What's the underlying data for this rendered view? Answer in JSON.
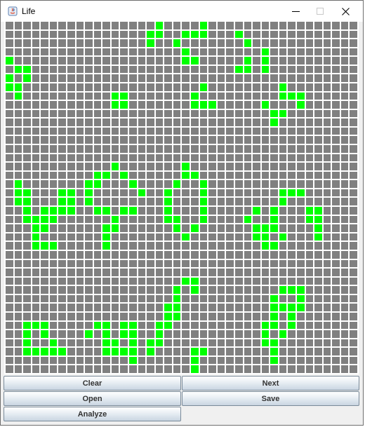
{
  "window": {
    "title": "Life"
  },
  "titlebar": {
    "icon": "java-icon",
    "controls": [
      "minimize-icon",
      "maximize-icon",
      "close-icon"
    ]
  },
  "board": {
    "rows": 40,
    "cols": 40,
    "alive_color": "#00ff00",
    "dead_color": "#808080",
    "grid_line_color": "#ffffff",
    "alive_cells": [
      [
        0,
        17
      ],
      [
        0,
        22
      ],
      [
        1,
        16
      ],
      [
        1,
        17
      ],
      [
        1,
        20
      ],
      [
        1,
        21
      ],
      [
        1,
        22
      ],
      [
        1,
        26
      ],
      [
        2,
        16
      ],
      [
        2,
        19
      ],
      [
        2,
        27
      ],
      [
        3,
        20
      ],
      [
        3,
        29
      ],
      [
        4,
        0
      ],
      [
        4,
        20
      ],
      [
        4,
        21
      ],
      [
        4,
        27
      ],
      [
        4,
        29
      ],
      [
        5,
        1
      ],
      [
        5,
        2
      ],
      [
        5,
        26
      ],
      [
        5,
        27
      ],
      [
        5,
        29
      ],
      [
        6,
        0
      ],
      [
        6,
        2
      ],
      [
        7,
        0
      ],
      [
        7,
        1
      ],
      [
        7,
        22
      ],
      [
        7,
        31
      ],
      [
        8,
        1
      ],
      [
        8,
        12
      ],
      [
        8,
        13
      ],
      [
        8,
        21
      ],
      [
        8,
        31
      ],
      [
        8,
        32
      ],
      [
        8,
        33
      ],
      [
        9,
        12
      ],
      [
        9,
        13
      ],
      [
        9,
        21
      ],
      [
        9,
        22
      ],
      [
        9,
        23
      ],
      [
        9,
        29
      ],
      [
        9,
        33
      ],
      [
        10,
        30
      ],
      [
        10,
        31
      ],
      [
        11,
        30
      ],
      [
        16,
        12
      ],
      [
        16,
        20
      ],
      [
        17,
        10
      ],
      [
        17,
        11
      ],
      [
        17,
        13
      ],
      [
        17,
        20
      ],
      [
        17,
        21
      ],
      [
        18,
        1
      ],
      [
        18,
        9
      ],
      [
        18,
        10
      ],
      [
        18,
        14
      ],
      [
        18,
        19
      ],
      [
        18,
        22
      ],
      [
        19,
        1
      ],
      [
        19,
        2
      ],
      [
        19,
        6
      ],
      [
        19,
        7
      ],
      [
        19,
        9
      ],
      [
        19,
        15
      ],
      [
        19,
        18
      ],
      [
        19,
        22
      ],
      [
        19,
        31
      ],
      [
        19,
        32
      ],
      [
        19,
        33
      ],
      [
        20,
        1
      ],
      [
        20,
        2
      ],
      [
        20,
        6
      ],
      [
        20,
        7
      ],
      [
        20,
        9
      ],
      [
        20,
        18
      ],
      [
        20,
        22
      ],
      [
        20,
        31
      ],
      [
        21,
        2
      ],
      [
        21,
        4
      ],
      [
        21,
        5
      ],
      [
        21,
        6
      ],
      [
        21,
        7
      ],
      [
        21,
        10
      ],
      [
        21,
        11
      ],
      [
        21,
        13
      ],
      [
        21,
        14
      ],
      [
        21,
        18
      ],
      [
        21,
        22
      ],
      [
        21,
        28
      ],
      [
        21,
        30
      ],
      [
        21,
        34
      ],
      [
        21,
        35
      ],
      [
        22,
        2
      ],
      [
        22,
        3
      ],
      [
        22,
        4
      ],
      [
        22,
        5
      ],
      [
        22,
        12
      ],
      [
        22,
        18
      ],
      [
        22,
        19
      ],
      [
        22,
        22
      ],
      [
        22,
        27
      ],
      [
        22,
        30
      ],
      [
        22,
        34
      ],
      [
        22,
        35
      ],
      [
        23,
        3
      ],
      [
        23,
        4
      ],
      [
        23,
        11
      ],
      [
        23,
        12
      ],
      [
        23,
        19
      ],
      [
        23,
        21
      ],
      [
        23,
        28
      ],
      [
        23,
        29
      ],
      [
        23,
        30
      ],
      [
        23,
        35
      ],
      [
        24,
        3
      ],
      [
        24,
        11
      ],
      [
        24,
        20
      ],
      [
        24,
        28
      ],
      [
        24,
        29
      ],
      [
        24,
        31
      ],
      [
        24,
        35
      ],
      [
        25,
        3
      ],
      [
        25,
        4
      ],
      [
        25,
        5
      ],
      [
        25,
        11
      ],
      [
        25,
        29
      ],
      [
        25,
        30
      ],
      [
        29,
        20
      ],
      [
        29,
        21
      ],
      [
        30,
        19
      ],
      [
        30,
        21
      ],
      [
        30,
        31
      ],
      [
        30,
        32
      ],
      [
        30,
        33
      ],
      [
        31,
        19
      ],
      [
        31,
        30
      ],
      [
        31,
        33
      ],
      [
        32,
        18
      ],
      [
        32,
        19
      ],
      [
        32,
        30
      ],
      [
        32,
        31
      ],
      [
        32,
        32
      ],
      [
        32,
        33
      ],
      [
        33,
        18
      ],
      [
        33,
        19
      ],
      [
        33,
        30
      ],
      [
        33,
        32
      ],
      [
        34,
        2
      ],
      [
        34,
        3
      ],
      [
        34,
        4
      ],
      [
        34,
        10
      ],
      [
        34,
        11
      ],
      [
        34,
        13
      ],
      [
        34,
        14
      ],
      [
        34,
        17
      ],
      [
        34,
        18
      ],
      [
        34,
        29
      ],
      [
        34,
        30
      ],
      [
        34,
        32
      ],
      [
        35,
        2
      ],
      [
        35,
        4
      ],
      [
        35,
        9
      ],
      [
        35,
        11
      ],
      [
        35,
        13
      ],
      [
        35,
        14
      ],
      [
        35,
        17
      ],
      [
        35,
        29
      ],
      [
        35,
        31
      ],
      [
        36,
        2
      ],
      [
        36,
        5
      ],
      [
        36,
        11
      ],
      [
        36,
        12
      ],
      [
        36,
        14
      ],
      [
        36,
        16
      ],
      [
        36,
        17
      ],
      [
        36,
        29
      ],
      [
        36,
        30
      ],
      [
        37,
        2
      ],
      [
        37,
        3
      ],
      [
        37,
        4
      ],
      [
        37,
        5
      ],
      [
        37,
        6
      ],
      [
        37,
        11
      ],
      [
        37,
        12
      ],
      [
        37,
        13
      ],
      [
        37,
        14
      ],
      [
        37,
        16
      ],
      [
        37,
        21
      ],
      [
        37,
        22
      ],
      [
        37,
        30
      ],
      [
        38,
        14
      ],
      [
        38,
        21
      ],
      [
        38,
        30
      ],
      [
        39,
        21
      ]
    ]
  },
  "buttons": {
    "clear": "Clear",
    "next": "Next",
    "open": "Open",
    "save": "Save",
    "analyze": "Analyze"
  }
}
